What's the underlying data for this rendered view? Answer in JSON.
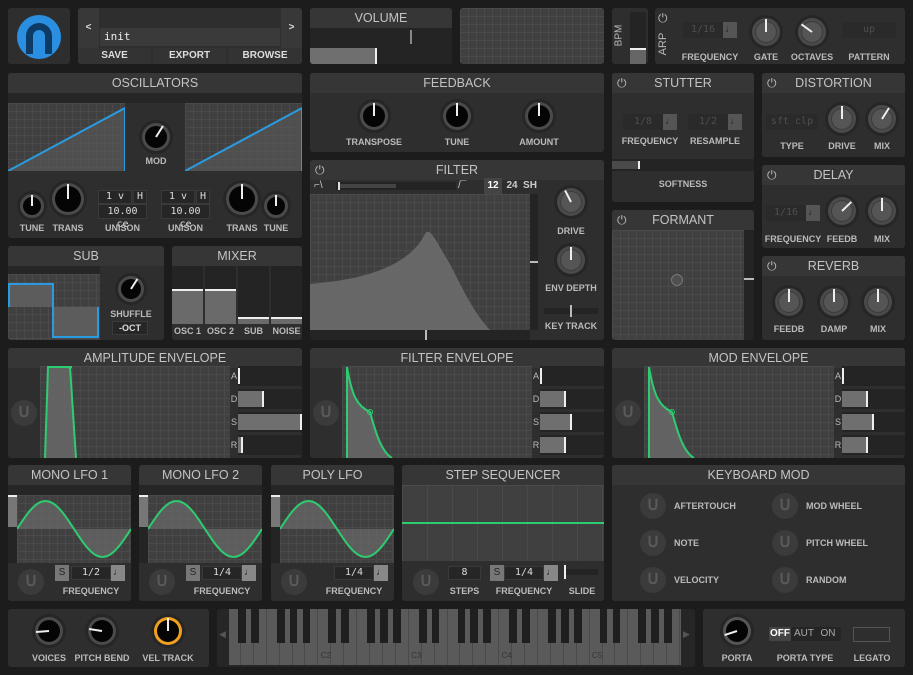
{
  "patch": {
    "prev": "<",
    "next": ">",
    "name": "init",
    "save": "SAVE",
    "export": "EXPORT",
    "browse": "BROWSE"
  },
  "volume": {
    "title": "VOLUME",
    "level": 0.47
  },
  "bpm": {
    "label": "BPM"
  },
  "arp": {
    "label": "ARP",
    "frequency": "1/16",
    "frequency_label": "FREQUENCY",
    "gate_label": "GATE",
    "octaves_label": "OCTAVES",
    "pattern": "up",
    "pattern_label": "PATTERN",
    "gate": 0.5,
    "octaves": 0.3
  },
  "oscillators": {
    "title": "OSCILLATORS",
    "mod_label": "MOD",
    "mod": 0.62,
    "tune_label": "TUNE",
    "trans_label": "TRANS",
    "unison_label": "UNISON",
    "osc1": {
      "voices": "1 v",
      "harmonize": "H",
      "detune": "10.00 ce",
      "tune": 0.5,
      "trans": 0.5
    },
    "osc2": {
      "voices": "1 v",
      "harmonize": "H",
      "detune": "10.00 ce",
      "tune": 0.5,
      "trans": 0.5
    },
    "wave_color": "#2a9be0"
  },
  "feedback": {
    "title": "FEEDBACK",
    "transpose_label": "TRANSPOSE",
    "tune_label": "TUNE",
    "amount_label": "AMOUNT",
    "transpose": 0.5,
    "tune": 0.5,
    "amount": 0.5
  },
  "filter": {
    "title": "FILTER",
    "slopes": [
      "12",
      "24",
      "SH"
    ],
    "active_slope": "12",
    "drive_label": "DRIVE",
    "env_depth_label": "ENV DEPTH",
    "key_track_label": "KEY TRACK",
    "drive": 0.4,
    "env_depth": 0.5,
    "key_track": 0.5
  },
  "stutter": {
    "title": "STUTTER",
    "frequency": "1/8",
    "frequency_label": "FREQUENCY",
    "resample": "1/2",
    "resample_label": "RESAMPLE",
    "softness_label": "SOFTNESS",
    "softness": 0.2
  },
  "formant": {
    "title": "FORMANT"
  },
  "distortion": {
    "title": "DISTORTION",
    "type": "sft clp",
    "type_label": "TYPE",
    "drive_label": "DRIVE",
    "mix_label": "MIX",
    "drive": 0.5,
    "mix": 0.62
  },
  "delay": {
    "title": "DELAY",
    "frequency": "1/16",
    "frequency_label": "FREQUENCY",
    "feedb_label": "FEEDB",
    "mix_label": "MIX",
    "feedb": 0.67,
    "mix": 0.5
  },
  "reverb": {
    "title": "REVERB",
    "feedb_label": "FEEDB",
    "damp_label": "DAMP",
    "mix_label": "MIX",
    "feedb": 0.5,
    "damp": 0.5,
    "mix": 0.5
  },
  "sub": {
    "title": "SUB",
    "shuffle_label": "SHUFFLE",
    "shuffle": 0.62,
    "octave": "-OCT"
  },
  "mixer": {
    "title": "MIXER",
    "channels": [
      {
        "label": "OSC 1",
        "level": 0.6
      },
      {
        "label": "OSC 2",
        "level": 0.6
      },
      {
        "label": "SUB",
        "level": 0.12
      },
      {
        "label": "NOISE",
        "level": 0.12
      }
    ]
  },
  "envelopes": [
    {
      "title": "AMPLITUDE ENVELOPE",
      "adsr": [
        {
          "k": "A",
          "v": 0.02
        },
        {
          "k": "D",
          "v": 0.4
        },
        {
          "k": "S",
          "v": 1.0
        },
        {
          "k": "R",
          "v": 0.08
        }
      ]
    },
    {
      "title": "FILTER ENVELOPE",
      "adsr": [
        {
          "k": "A",
          "v": 0.02
        },
        {
          "k": "D",
          "v": 0.4
        },
        {
          "k": "S",
          "v": 0.5
        },
        {
          "k": "R",
          "v": 0.4
        }
      ]
    },
    {
      "title": "MOD ENVELOPE",
      "adsr": [
        {
          "k": "A",
          "v": 0.02
        },
        {
          "k": "D",
          "v": 0.4
        },
        {
          "k": "S",
          "v": 0.5
        },
        {
          "k": "R",
          "v": 0.4
        }
      ]
    }
  ],
  "lfos": [
    {
      "title": "MONO LFO 1",
      "sync": "S",
      "frequency": "1/2",
      "frequency_label": "FREQUENCY"
    },
    {
      "title": "MONO LFO 2",
      "sync": "S",
      "frequency": "1/4",
      "frequency_label": "FREQUENCY"
    },
    {
      "title": "POLY LFO",
      "frequency": "1/4",
      "frequency_label": "FREQUENCY"
    }
  ],
  "step_sequencer": {
    "title": "STEP SEQUENCER",
    "steps": "8",
    "steps_label": "STEPS",
    "sync": "S",
    "frequency": "1/4",
    "frequency_label": "FREQUENCY",
    "slide_label": "SLIDE"
  },
  "keyboard_mod": {
    "title": "KEYBOARD MOD",
    "sources": [
      "AFTERTOUCH",
      "MOD WHEEL",
      "NOTE",
      "PITCH WHEEL",
      "VELOCITY",
      "RANDOM"
    ]
  },
  "performance": {
    "voices_label": "VOICES",
    "pitch_bend_label": "PITCH BEND",
    "vel_track_label": "VEL TRACK",
    "voices": 0.15,
    "pitch_bend": 0.2,
    "vel_track": 0.5,
    "accent": "#f0a020"
  },
  "keyboard": {
    "octave_labels": [
      "C2",
      "C3",
      "C4",
      "C5"
    ]
  },
  "portamento": {
    "porta_label": "PORTA",
    "porta": 0.1,
    "porta_type_options": [
      "OFF",
      "AUT",
      "ON"
    ],
    "porta_type": "OFF",
    "porta_type_label": "PORTA TYPE",
    "legato_label": "LEGATO"
  },
  "mod_icon": "helm-logo-icon",
  "colors": {
    "wave": "#2a9be0",
    "envelope": "#2ecc71",
    "accent": "#f0a020"
  }
}
